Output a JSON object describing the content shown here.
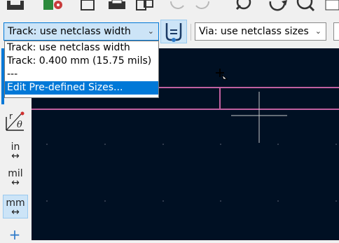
{
  "track_width": {
    "selected": "Track: use netclass width",
    "options": [
      "Track: use netclass width",
      "Track: 0.400 mm (15.75 mils)",
      "---",
      "Edit Pre-defined Sizes..."
    ],
    "highlighted_index": 3
  },
  "via_size": {
    "selected": "Via: use netclass sizes"
  },
  "units": {
    "inches": "in",
    "mils": "mil",
    "millimeters": "mm",
    "active": "mm"
  },
  "colors": {
    "canvas_bg": "#001023",
    "track": "#c060a0",
    "grid": "#6a7080",
    "cursor": "#c8c8c8",
    "highlight": "#0078d7"
  }
}
